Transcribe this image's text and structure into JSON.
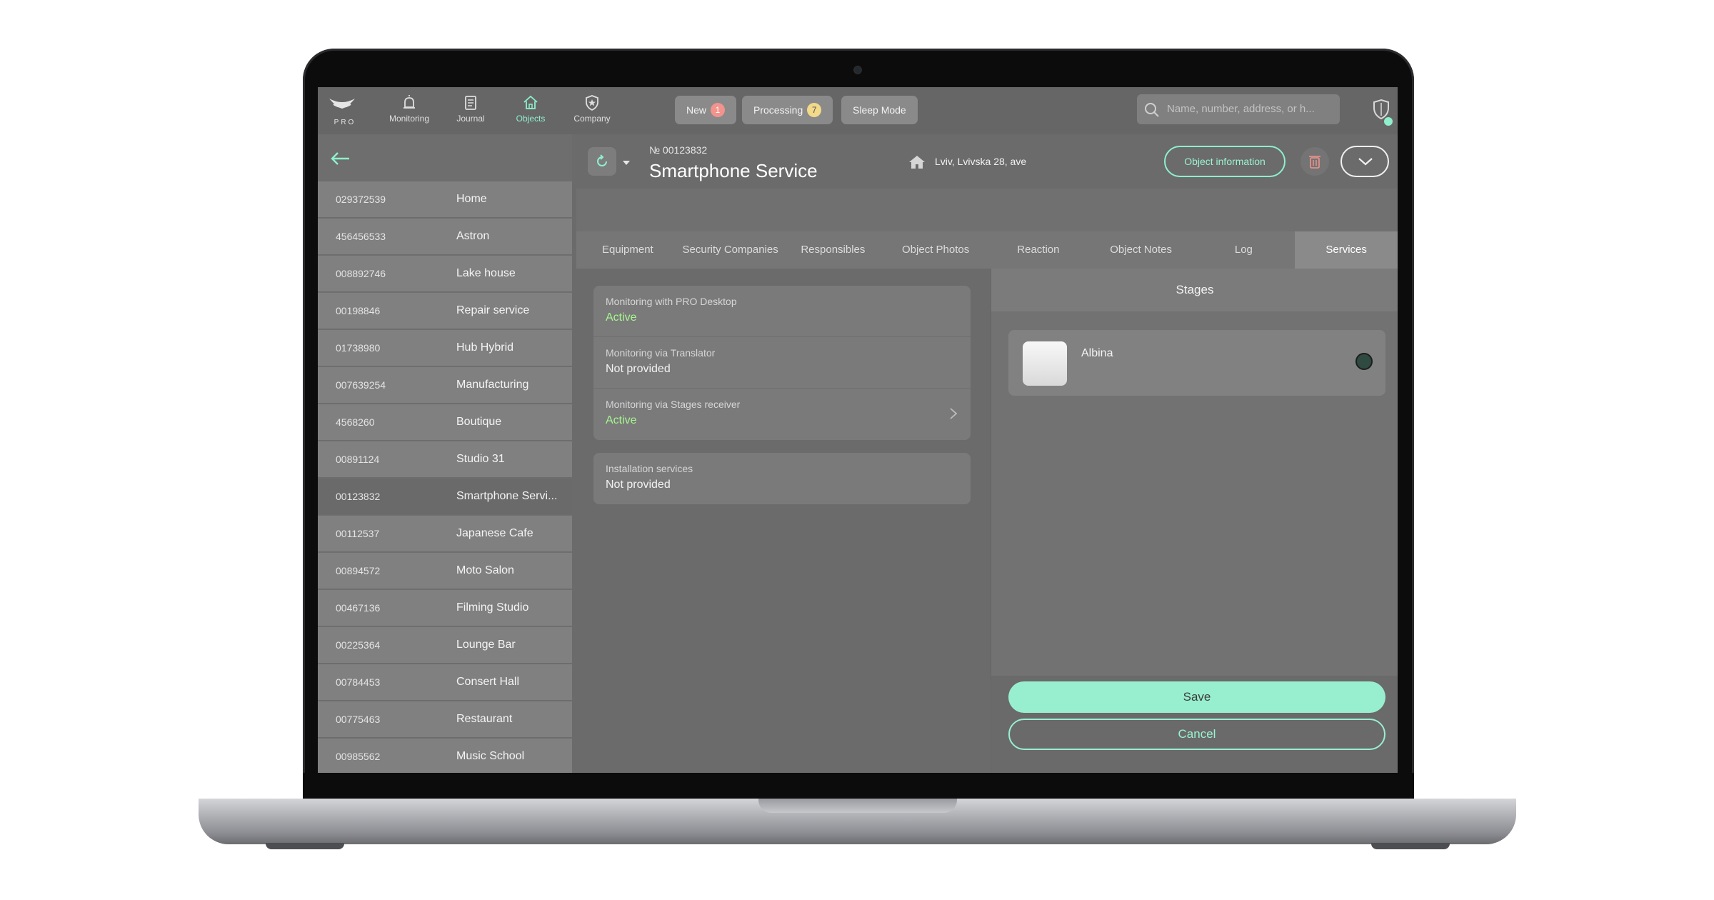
{
  "app": {
    "logo_text": "PRO"
  },
  "nav": {
    "items": [
      {
        "label": "Monitoring",
        "icon": "bell-icon"
      },
      {
        "label": "Journal",
        "icon": "journal-icon"
      },
      {
        "label": "Objects",
        "icon": "home-icon",
        "active": true
      },
      {
        "label": "Company",
        "icon": "shield-star-icon"
      }
    ]
  },
  "status_pills": {
    "new": {
      "label": "New",
      "count": "1"
    },
    "processing": {
      "label": "Processing",
      "count": "7"
    },
    "sleep": {
      "label": "Sleep Mode"
    }
  },
  "search": {
    "placeholder": "Name, number, address, or h..."
  },
  "objects": [
    {
      "number": "029372539",
      "name": "Home"
    },
    {
      "number": "456456533",
      "name": "Astron"
    },
    {
      "number": "008892746",
      "name": "Lake house"
    },
    {
      "number": "00198846",
      "name": "Repair service"
    },
    {
      "number": "01738980",
      "name": "Hub Hybrid"
    },
    {
      "number": "007639254",
      "name": "Manufacturing"
    },
    {
      "number": "4568260",
      "name": "Boutique"
    },
    {
      "number": "00891124",
      "name": "Studio 31"
    },
    {
      "number": "00123832",
      "name": "Smartphone Servi...",
      "selected": true
    },
    {
      "number": "00112537",
      "name": "Japanese Cafe"
    },
    {
      "number": "00894572",
      "name": "Moto Salon"
    },
    {
      "number": "00467136",
      "name": "Filming Studio"
    },
    {
      "number": "00225364",
      "name": "Lounge Bar"
    },
    {
      "number": "00784453",
      "name": "Consert Hall"
    },
    {
      "number": "00775463",
      "name": "Restaurant"
    },
    {
      "number": "00985562",
      "name": "Music School"
    }
  ],
  "object": {
    "number_label": "№ 00123832",
    "title": "Smartphone Service",
    "address": "Lviv, Lvivska 28, ave",
    "info_button": "Object information"
  },
  "tabs": [
    {
      "label": "Equipment"
    },
    {
      "label": "Security Companies"
    },
    {
      "label": "Responsibles"
    },
    {
      "label": "Object Photos"
    },
    {
      "label": "Reaction"
    },
    {
      "label": "Object Notes"
    },
    {
      "label": "Log"
    },
    {
      "label": "Services",
      "active": true
    }
  ],
  "services": {
    "monitoring": [
      {
        "label": "Monitoring with PRO Desktop",
        "value": "Active",
        "status": "active"
      },
      {
        "label": "Monitoring via Translator",
        "value": "Not provided",
        "status": "none"
      },
      {
        "label": "Monitoring via Stages receiver",
        "value": "Active",
        "status": "active",
        "has_chevron": true
      }
    ],
    "installation": {
      "label": "Installation services",
      "value": "Not provided"
    }
  },
  "stages": {
    "title": "Stages",
    "items": [
      {
        "name": "Albina",
        "selected": true
      }
    ],
    "save_label": "Save",
    "cancel_label": "Cancel"
  },
  "colors": {
    "accent": "#8ef0cc",
    "active_green": "#a6f58f",
    "badge_red": "#f2938d",
    "badge_yellow": "#f3d98a"
  }
}
